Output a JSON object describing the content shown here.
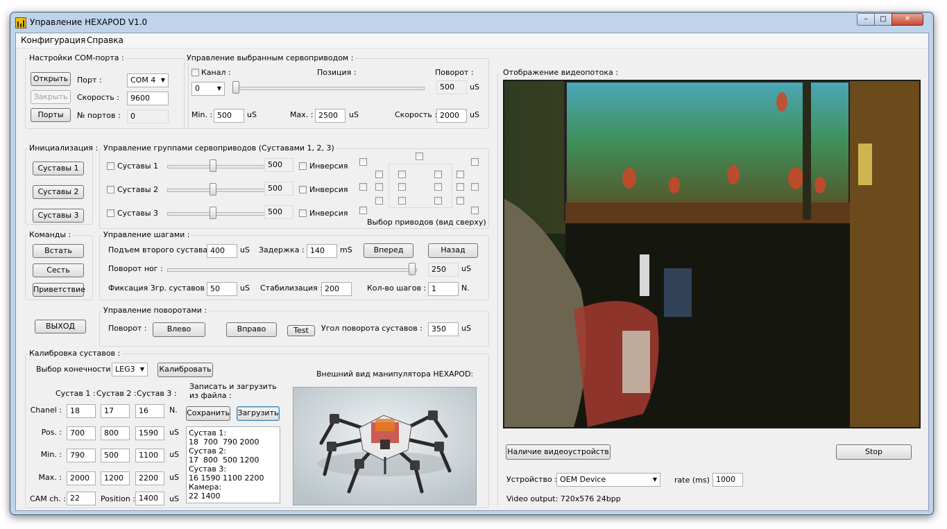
{
  "window": {
    "title": "Управление HEXAPOD V1.0",
    "minimize": "–",
    "maximize": "□",
    "close": "✕"
  },
  "menu": [
    "Конфигурация",
    "Справка"
  ],
  "com": {
    "title": "Настройки COM-порта :",
    "open": "Открыть",
    "close": "Закрыть",
    "ports": "Порты",
    "port_label": "Порт :",
    "port_value": "COM 4",
    "speed_label": "Скорость :",
    "speed_value": "9600",
    "num_label": "№ портов :",
    "num_value": "0"
  },
  "servo": {
    "title": "Управление выбранным сервоприводом :",
    "channel_label": "Канал :",
    "channel_value": "0",
    "position_label": "Позиция :",
    "rotation_label": "Поворот :",
    "rotation_value": "500",
    "unit_us": "uS",
    "min_label": "Min. :",
    "min_value": "500",
    "max_label": "Max. :",
    "max_value": "2500",
    "speed_label": "Скорость :",
    "speed_value": "2000",
    "slider_fraction": 0
  },
  "init": {
    "title": "Инициализация :",
    "buttons": [
      "Суставы 1",
      "Суставы 2",
      "Суставы 3"
    ]
  },
  "group": {
    "title": "Управление группами сервоприводов (Суставами 1, 2, 3)",
    "rows": [
      {
        "label": "Суставы 1",
        "value": "500",
        "inv": "Инверсия"
      },
      {
        "label": "Суставы 2",
        "value": "500",
        "inv": "Инверсия"
      },
      {
        "label": "Суставы 3",
        "value": "500",
        "inv": "Инверсия"
      }
    ],
    "select_label": "Выбор приводов (вид сверху)"
  },
  "commands": {
    "title": "Команды :",
    "buttons": [
      "Встать",
      "Сесть",
      "Приветствие"
    ],
    "exit": "ВЫХОД"
  },
  "steps": {
    "title": "Управление шагами :",
    "lift_label": "Подъем второго сустава :",
    "lift_value": "400",
    "lift_unit": "uS",
    "delay_label": "Задержка :",
    "delay_value": "140",
    "delay_unit": "mS",
    "forward": "Вперед",
    "back": "Назад",
    "turn_label": "Поворот ног :",
    "turn_value": "250",
    "turn_unit": "uS",
    "fix_label": "Фиксация 3гр. суставов :",
    "fix_value": "50",
    "fix_unit": "uS",
    "stab_label": "Стабилизация :",
    "stab_value": "200",
    "count_label": "Кол-во шагов :",
    "count_value": "1",
    "count_unit": "N."
  },
  "turns": {
    "title": "Управление поворотами :",
    "turn_label": "Поворот :",
    "left": "Влево",
    "right": "Вправо",
    "test": "Test",
    "angle_label": "Угол поворота суставов :",
    "angle_value": "350",
    "angle_unit": "uS"
  },
  "calib": {
    "title": "Калибровка суставов :",
    "limb_label": "Выбор конечности :",
    "limb_value": "LEG3",
    "calibrate": "Калибровать",
    "col_headers": [
      "Сустав 1 :",
      "Сустав 2 :",
      "Сустав 3 :"
    ],
    "rows": [
      {
        "label": "Chanel :",
        "values": [
          "18",
          "17",
          "16"
        ],
        "unit": "N."
      },
      {
        "label": "Pos. :",
        "values": [
          "700",
          "800",
          "1590"
        ],
        "unit": "uS"
      },
      {
        "label": "Min. :",
        "values": [
          "790",
          "500",
          "1100"
        ],
        "unit": "uS"
      },
      {
        "label": "Max. :",
        "values": [
          "2000",
          "1200",
          "2200"
        ],
        "unit": "uS"
      }
    ],
    "cam_label": "CAM ch. :",
    "cam_value": "22",
    "pos_label": "Position :",
    "pos_value": "1400",
    "pos_unit": "uS",
    "file_label": "Записать и загрузить из файла :",
    "save": "Сохранить",
    "load": "Загрузить",
    "text_lines": [
      "Сустав 1:",
      "18  700  790 2000",
      "Сустав 2:",
      "17  800  500 1200",
      "Сустав 3:",
      "16 1590 1100 2200",
      "Камера:",
      "22 1400"
    ],
    "appearance_label": "Внешний вид манипулятора HEXAPOD:"
  },
  "video": {
    "title": "Отображение видеопотока :",
    "devices_btn": "Наличие видеоустройств",
    "stop": "Stop",
    "device_label": "Устройство :",
    "device_value": "OEM Device",
    "rate_label": "rate (ms)",
    "rate_value": "1000",
    "output": "Video output:  720x576 24bpp"
  }
}
